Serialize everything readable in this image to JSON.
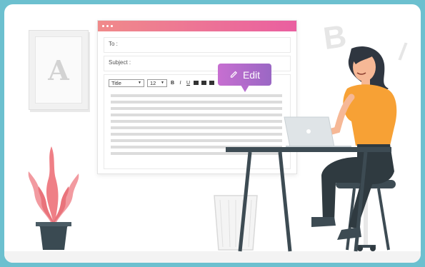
{
  "window": {
    "to_label": "To :",
    "subject_label": "Subject :",
    "toolbar": {
      "style_select": "Title",
      "size_select": "12",
      "bold": "B",
      "italic": "I",
      "underline": "U"
    }
  },
  "edit_bubble": {
    "label": "Edit",
    "icon": "pencil-icon"
  },
  "decor": {
    "frame_letter": "A",
    "wall_letter": "B",
    "wall_mark": "/"
  },
  "colors": {
    "background": "#6cc0cf",
    "titlebar_start": "#f08a8a",
    "titlebar_end": "#ea5fa0",
    "bubble_start": "#c76fd1",
    "bubble_end": "#9a67c4",
    "shirt": "#f7a135",
    "plant": "#ef7f86"
  }
}
